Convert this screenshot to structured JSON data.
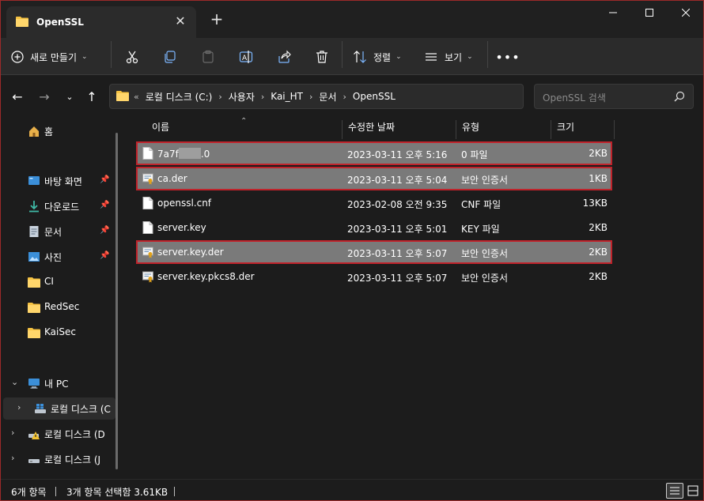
{
  "window": {
    "tab_title": "OpenSSL",
    "icons": {
      "folder": "folder-icon",
      "close": "close-icon",
      "new_tab": "plus-icon",
      "minimize": "minimize-icon",
      "maximize": "maximize-icon",
      "window_close": "window-close-icon"
    },
    "accent": "#f5c242"
  },
  "toolbar": {
    "new_label": "새로 만들기",
    "sort_label": "정렬",
    "view_label": "보기",
    "icons": [
      "cut-icon",
      "copy-icon",
      "paste-icon",
      "rename-icon",
      "share-icon",
      "delete-icon",
      "more-icon"
    ]
  },
  "address": {
    "overflow": "«",
    "crumbs": [
      "로컬 디스크 (C:)",
      "사용자",
      "Kai_HT",
      "문서",
      "OpenSSL"
    ],
    "search_placeholder": "OpenSSL 검색"
  },
  "sidebar": {
    "items": [
      {
        "label": "홈",
        "icon": "home-icon"
      },
      {
        "label": "바탕 화면",
        "icon": "desktop-icon",
        "pinned": true
      },
      {
        "label": "다운로드",
        "icon": "download-icon",
        "pinned": true
      },
      {
        "label": "문서",
        "icon": "documents-icon",
        "pinned": true
      },
      {
        "label": "사진",
        "icon": "pictures-icon",
        "pinned": true
      },
      {
        "label": "CI",
        "icon": "folder-icon"
      },
      {
        "label": "RedSec",
        "icon": "folder-icon"
      },
      {
        "label": "KaiSec",
        "icon": "folder-icon"
      },
      {
        "label": "내 PC",
        "icon": "pc-icon",
        "expanded": true
      },
      {
        "label": "로컬 디스크 (C",
        "icon": "drive-windows-icon",
        "selected": true
      },
      {
        "label": "로컬 디스크 (D",
        "icon": "drive-warning-icon"
      },
      {
        "label": "로컬 디스크 (J",
        "icon": "drive-icon"
      }
    ],
    "pin_glyph": "📌"
  },
  "list": {
    "columns": {
      "name": "이름",
      "date": "수정한 날짜",
      "type": "유형",
      "size": "크기"
    },
    "files": [
      {
        "name_prefix": "7a7f",
        "name_suffix": ".0",
        "redacted": true,
        "date": "2023-03-11 오후 5:16",
        "type": "0 파일",
        "size": "2KB",
        "selected": true,
        "icon": "file-icon"
      },
      {
        "name": "ca.der",
        "date": "2023-03-11 오후 5:04",
        "type": "보안 인증서",
        "size": "1KB",
        "selected": true,
        "icon": "certificate-icon"
      },
      {
        "name": "openssl.cnf",
        "date": "2023-02-08 오전 9:35",
        "type": "CNF 파일",
        "size": "13KB",
        "selected": false,
        "icon": "file-icon"
      },
      {
        "name": "server.key",
        "date": "2023-03-11 오후 5:01",
        "type": "KEY 파일",
        "size": "2KB",
        "selected": false,
        "icon": "file-icon"
      },
      {
        "name": "server.key.der",
        "date": "2023-03-11 오후 5:07",
        "type": "보안 인증서",
        "size": "2KB",
        "selected": true,
        "icon": "certificate-icon"
      },
      {
        "name": "server.key.pkcs8.der",
        "date": "2023-03-11 오후 5:07",
        "type": "보안 인증서",
        "size": "2KB",
        "selected": false,
        "icon": "certificate-icon"
      }
    ]
  },
  "status": {
    "count": "6개 항목",
    "selection": "3개 항목 선택함 3.61KB"
  }
}
